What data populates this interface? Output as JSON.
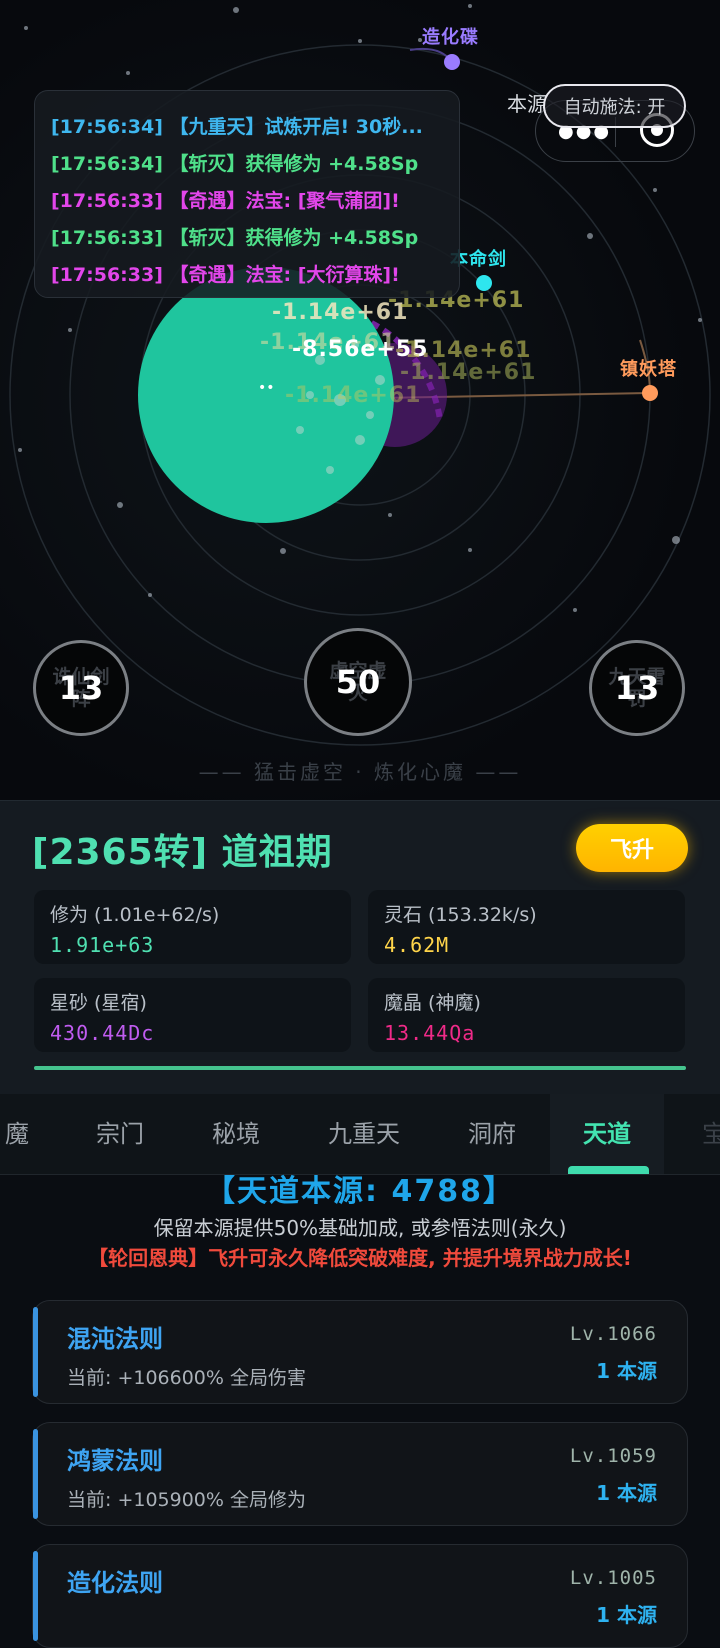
{
  "colors": {
    "accent_green": "#4fe0b1",
    "log_cyan": "#3fb7ef",
    "log_green": "#4fe08a",
    "log_magenta": "#e246ea",
    "gold": "#ffd54a",
    "violet": "#c05cf0",
    "pink": "#ef2a88",
    "blue": "#3ea4f2",
    "red": "#f04a3c"
  },
  "scene": {
    "planet_labels": [
      {
        "text": "造化碟",
        "color": "#9a7cff"
      },
      {
        "text": "本命剑",
        "color": "#2ee6ee"
      },
      {
        "text": "镇妖塔",
        "color": "#ff9b5c"
      }
    ],
    "source_label": "本源",
    "auto_cast": "自动施法: 开",
    "damage_texts": [
      "-1.14e+61",
      "-1.14e+61",
      "-1.14e+61",
      "-8.56e+55",
      "-1.14e+61",
      "-1.14e+61",
      "-1.14e+61"
    ],
    "core_glyph": "••",
    "footer_slogan": "—— 猛击虚空 · 炼化心魔 ——"
  },
  "log": [
    {
      "text": "[17:56:34] 【九重天】试炼开启! 30秒...",
      "color": "#3fb7ef"
    },
    {
      "text": "[17:56:34] 【斩灭】获得修为 +4.58Sp",
      "color": "#4fe08a"
    },
    {
      "text": "[17:56:33] 【奇遇】法宝: [聚气蒲团]!",
      "color": "#e246ea"
    },
    {
      "text": "[17:56:33] 【斩灭】获得修为 +4.58Sp",
      "color": "#4fe08a"
    },
    {
      "text": "[17:56:33] 【奇遇】法宝: [大衍算珠]!",
      "color": "#e246ea"
    }
  ],
  "skills": [
    {
      "under": "诛仙剑阵",
      "value": "13"
    },
    {
      "under": "虚空虚灭",
      "value": "50"
    },
    {
      "under": "九天雷罚",
      "value": "13"
    }
  ],
  "status": {
    "realm": "[2365转] 道祖期",
    "ascend_label": "飞升",
    "stats": [
      {
        "label": "修为 (1.01e+62/s)",
        "value": "1.91e+63",
        "color": "#4fe0b1"
      },
      {
        "label": "灵石 (153.32k/s)",
        "value": "4.62M",
        "color": "#ffd54a"
      },
      {
        "label": "星砂 (星宿)",
        "value": "430.44Dc",
        "color": "#c05cf0"
      },
      {
        "label": "魔晶 (神魔)",
        "value": "13.44Qa",
        "color": "#ef2a88"
      }
    ],
    "progress": 1.0
  },
  "tabs": [
    "魔",
    "宗门",
    "秘境",
    "九重天",
    "洞府",
    "天道",
    "宝"
  ],
  "active_tab": "天道",
  "dao": {
    "headline": "【天道本源: 4788】",
    "note": "保留本源提供50%基础加成, 或参悟法则(永久)",
    "warning": "【轮回恩典】飞升可永久降低突破难度, 并提升境界战力成长!",
    "laws": [
      {
        "name": "混沌法则",
        "desc": "当前: +106600% 全局伤害",
        "level": "Lv.1066",
        "cost": "1 本源"
      },
      {
        "name": "鸿蒙法则",
        "desc": "当前: +105900% 全局修为",
        "level": "Lv.1059",
        "cost": "1 本源"
      },
      {
        "name": "造化法则",
        "desc": "",
        "level": "Lv.1005",
        "cost": "1 本源"
      }
    ]
  }
}
